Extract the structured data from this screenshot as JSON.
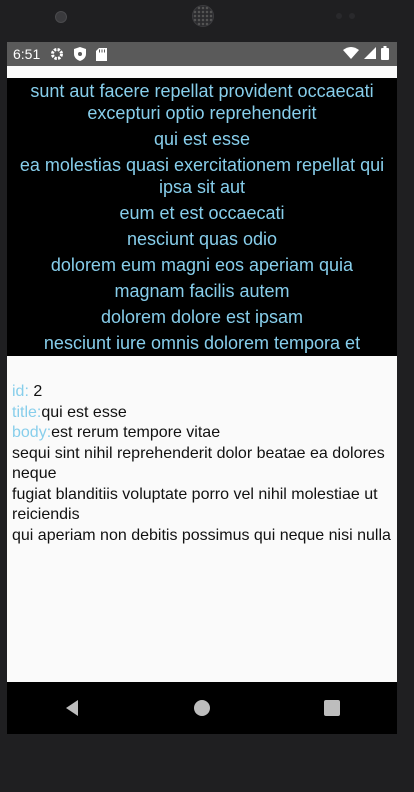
{
  "status_bar": {
    "time": "6:51",
    "icons_left": [
      "gear-icon",
      "shield-icon",
      "sd-card-icon"
    ],
    "icons_right": [
      "wifi-icon",
      "signal-icon",
      "battery-icon"
    ]
  },
  "posts": [
    "sunt aut facere repellat provident occaecati excepturi optio reprehenderit",
    "qui est esse",
    "ea molestias quasi exercitationem repellat qui ipsa sit aut",
    "eum et est occaecati",
    "nesciunt quas odio",
    "dolorem eum magni eos aperiam quia",
    "magnam facilis autem",
    "dolorem dolore est ipsam",
    "nesciunt iure omnis dolorem tempora et"
  ],
  "detail": {
    "id_label": "id:",
    "id_value": " 2",
    "title_label": "title:",
    "title_value": "qui est esse",
    "body_label": "body:",
    "body_value": "est rerum tempore vitae\nsequi sint nihil reprehenderit dolor beatae ea dolores neque\nfugiat blanditiis voluptate porro vel nihil molestiae ut reiciendis\nqui aperiam non debitis possimus qui neque nisi nulla"
  },
  "colors": {
    "accent_text": "#87ceeb",
    "list_background": "#000000",
    "detail_background": "#fafafa",
    "status_bar": "#5a5a5a"
  },
  "navigation": [
    "back-icon",
    "home-icon",
    "recents-icon"
  ]
}
